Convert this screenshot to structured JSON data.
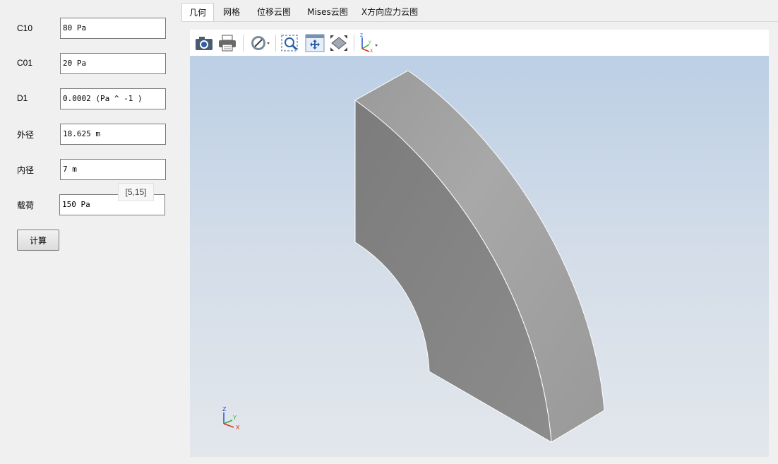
{
  "params": [
    {
      "label": "C10",
      "value": "80 Pa"
    },
    {
      "label": "C01",
      "value": "20 Pa"
    },
    {
      "label": "D1",
      "value": "0.0002 (Pa ^ -1 )"
    },
    {
      "label": "外径",
      "value": "18.625 m"
    },
    {
      "label": "内径",
      "value": "7 m"
    },
    {
      "label": "载荷",
      "value": "150 Pa"
    }
  ],
  "tooltip": "[5,15]",
  "calculate_label": "计算",
  "tabs": [
    {
      "label": "几何",
      "active": true
    },
    {
      "label": "网格",
      "active": false
    },
    {
      "label": "位移云图",
      "active": false
    },
    {
      "label": "Mises云图",
      "active": false
    },
    {
      "label": "X方向应力云图",
      "active": false
    }
  ],
  "toolbar_icons": [
    "camera-icon",
    "print-icon",
    "hide-icon",
    "zoom-fit-icon",
    "pan-icon",
    "fit-all-icon",
    "view-axes-icon"
  ],
  "axes": {
    "z": "Z",
    "y": "Y",
    "x": "X"
  },
  "colors": {
    "accent": "#2e5fa6",
    "axis_x": "#e03020",
    "axis_y": "#30b030",
    "axis_z": "#2050d0"
  }
}
